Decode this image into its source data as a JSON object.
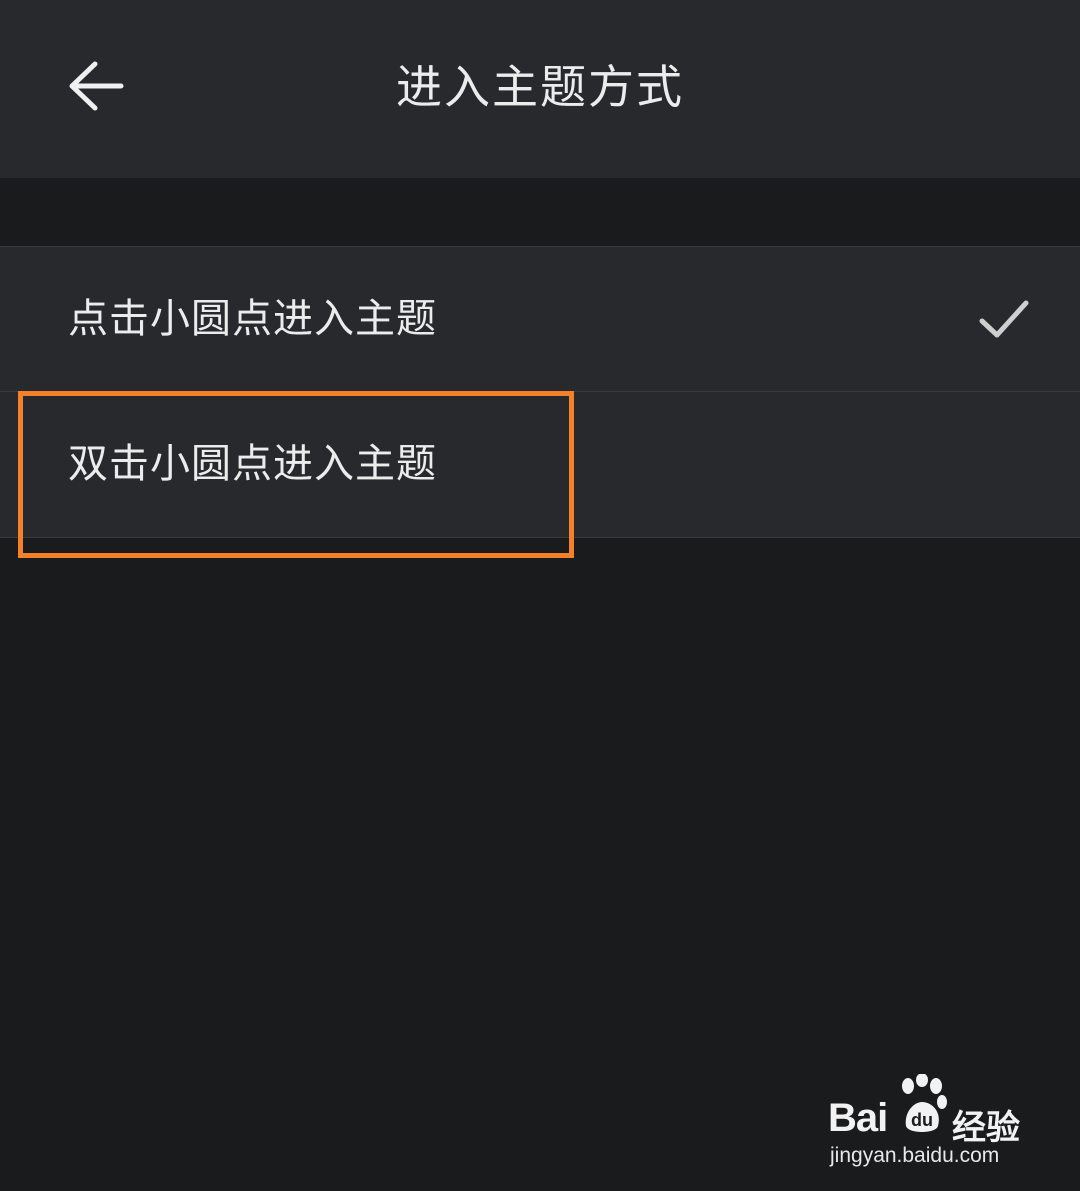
{
  "header": {
    "back_icon": "arrow-left-icon",
    "title": "进入主题方式"
  },
  "options": [
    {
      "label": "点击小圆点进入主题",
      "selected": true,
      "icon": "check-icon"
    },
    {
      "label": "双击小圆点进入主题",
      "selected": false
    }
  ],
  "annotation": {
    "color": "#f4812a"
  },
  "watermark": {
    "brand_prefix": "Bai",
    "brand_suffix": "经验",
    "url": "jingyan.baidu.com"
  },
  "colors": {
    "background": "#1a1b1d",
    "surface": "#28292c",
    "divider": "#3a3b3e",
    "text": "#ececec"
  }
}
